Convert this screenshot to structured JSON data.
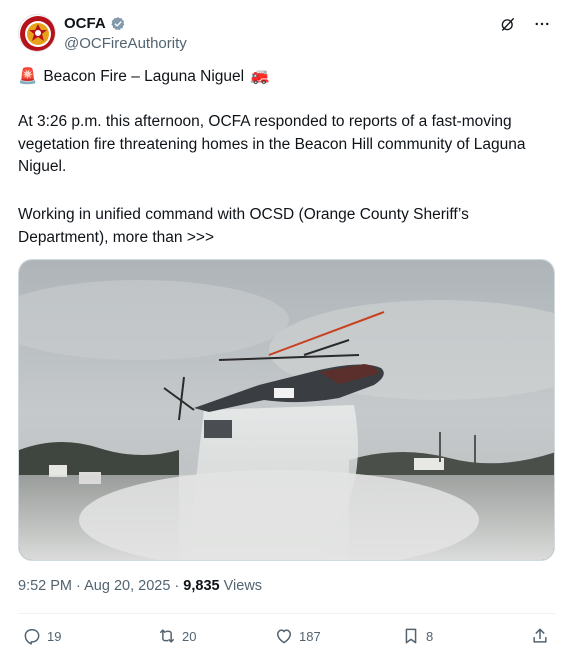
{
  "account": {
    "display_name": "OCFA",
    "handle": "@OCFireAuthority",
    "verified_color": "#829aab",
    "avatar_icon": "ocfa-badge-icon"
  },
  "post": {
    "title_emoji_left": "🚨",
    "title": "Beacon Fire – Laguna Niguel",
    "title_emoji_right": "🚒",
    "paragraph1": "At 3:26 p.m. this afternoon, OCFA responded to reports of a fast-moving vegetation fire threatening homes in the Beacon Hill community of Laguna Niguel.",
    "paragraph2": "Working in unified command with OCSD (Orange County Sheriff’s Department), more than >>>"
  },
  "media": {
    "type": "photo",
    "description_icon": "helicopter-water-drop-photo"
  },
  "meta": {
    "time": "9:52 PM",
    "separator": "·",
    "date": "Aug 20, 2025",
    "views_count": "9,835",
    "views_label": "Views"
  },
  "actions": {
    "replies": "19",
    "reposts": "20",
    "likes": "187",
    "bookmarks": "8"
  },
  "colors": {
    "text": "#0f1419",
    "secondary": "#536471",
    "border": "#cfd9de"
  }
}
